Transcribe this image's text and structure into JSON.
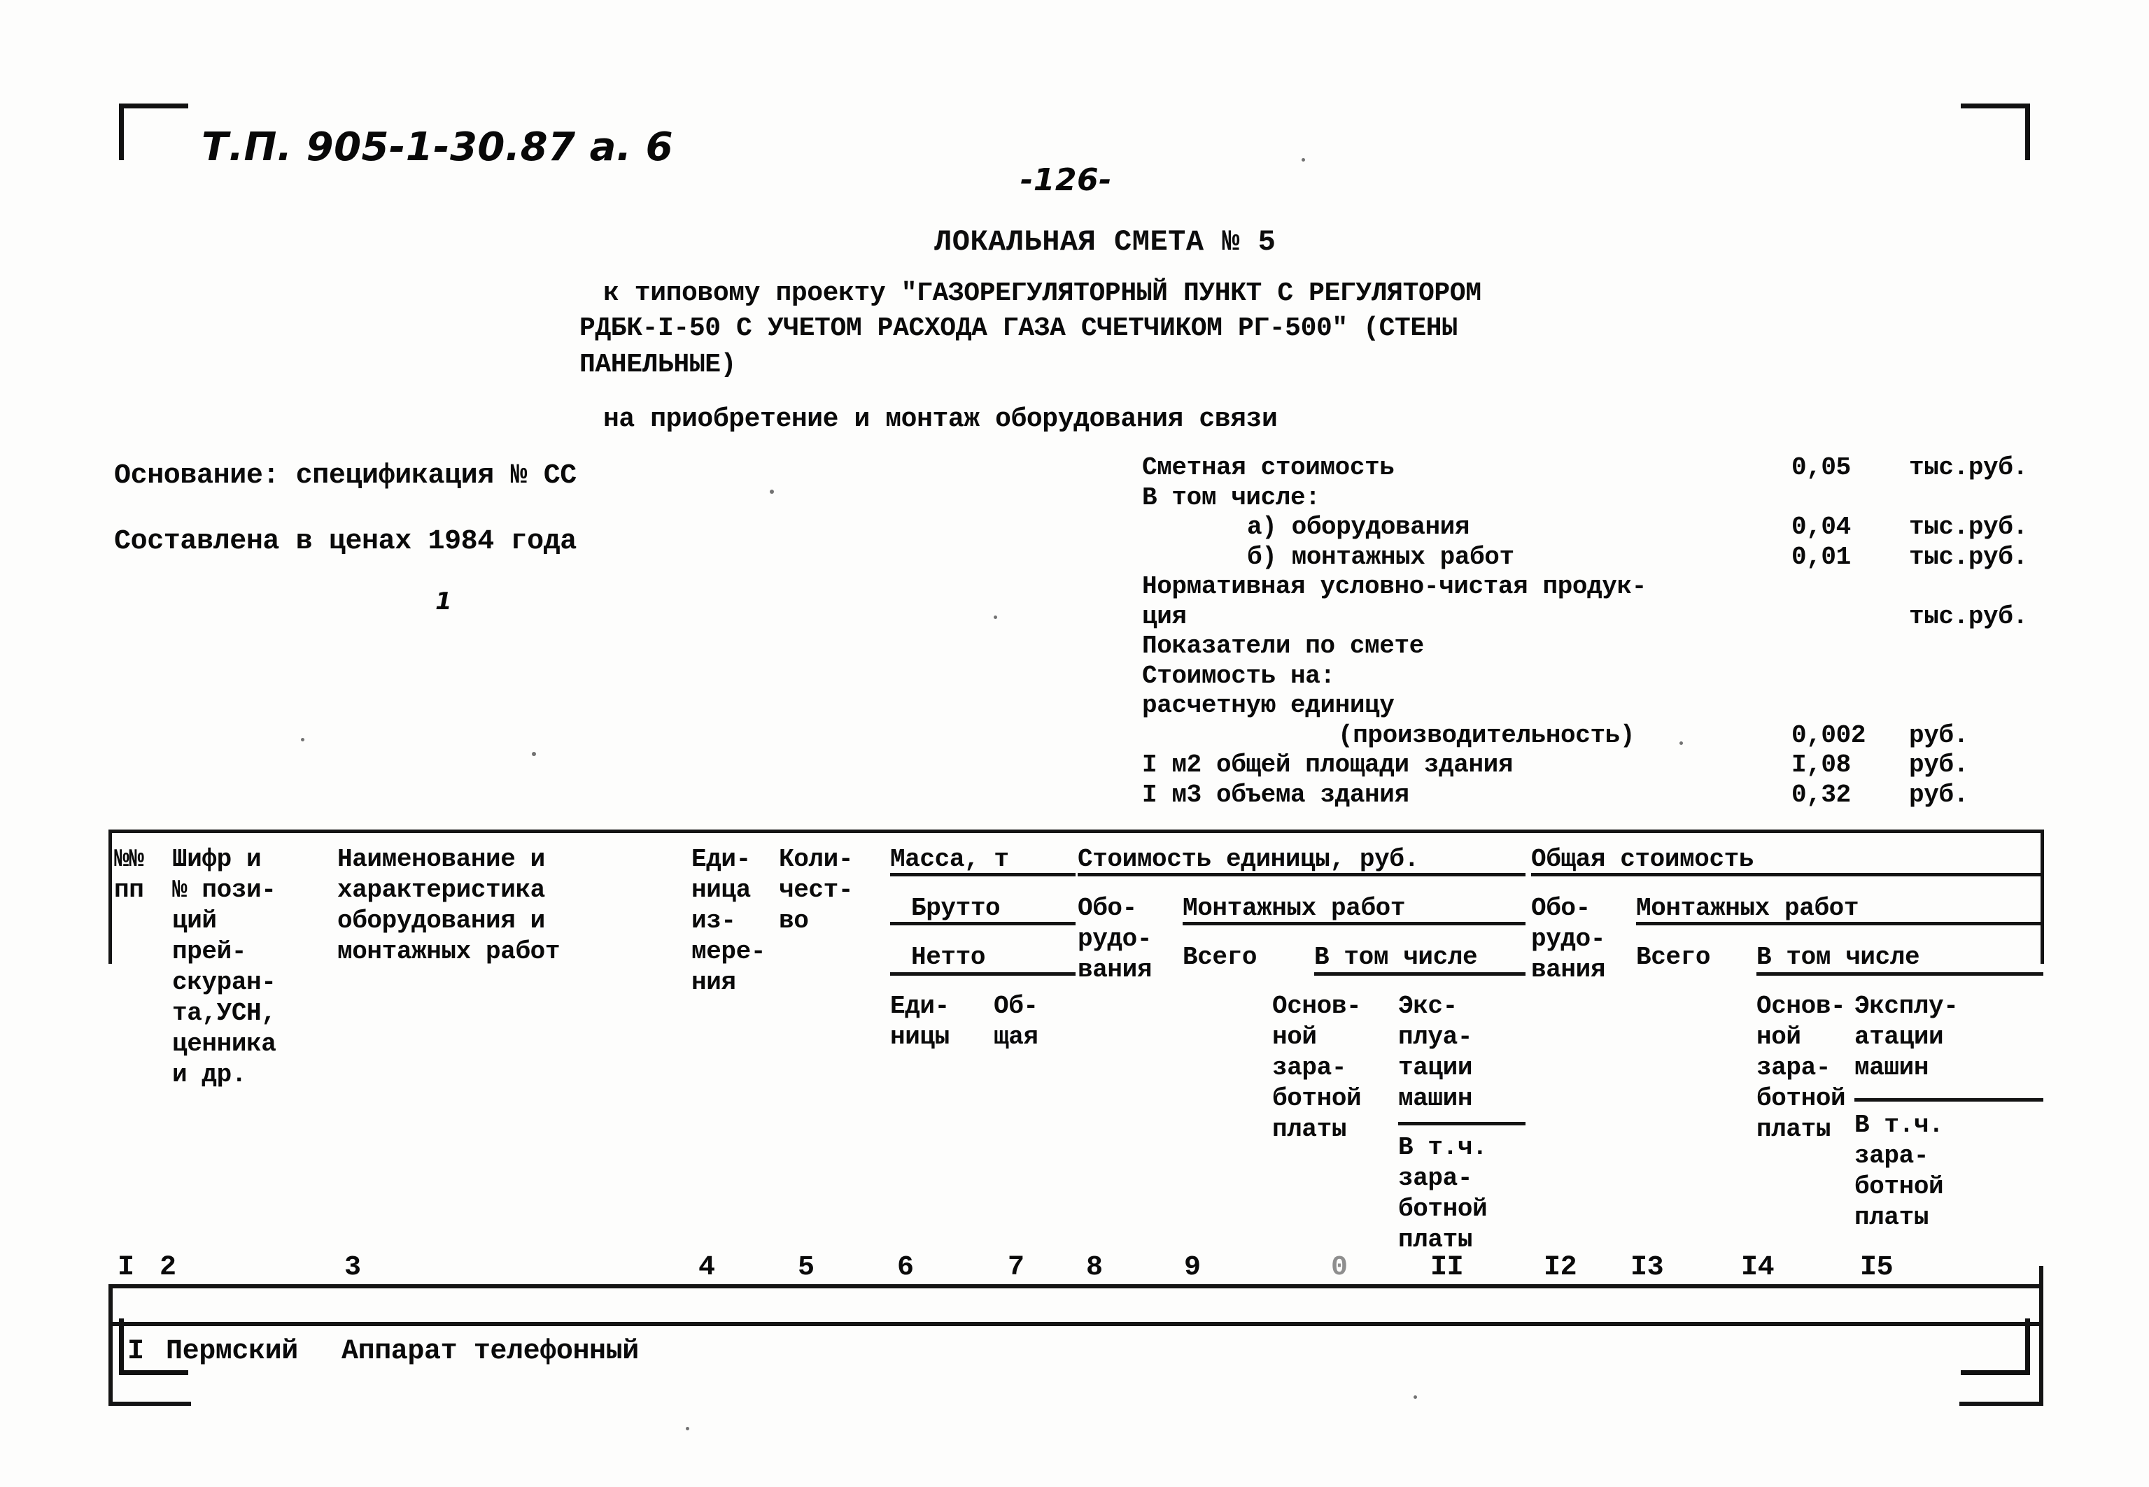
{
  "page": {
    "handwritten_ref": "Т.П. 905-1-30.87 а. 6",
    "page_number": "-126-"
  },
  "heading": {
    "title": "ЛОКАЛЬНАЯ СМЕТА № 5",
    "project_line1": "к типовому проекту \"ГАЗОРЕГУЛЯТОРНЫЙ ПУНКТ С РЕГУЛЯТОРОМ",
    "project_line2": "РДБК-I-50 С УЧЕТОМ РАСХОДА ГАЗА СЧЕТЧИКОМ РГ-500\" (СТЕНЫ",
    "project_line3": "ПАНЕЛЬНЫЕ)",
    "subtitle": "на приобретение и монтаж оборудования связи"
  },
  "left_info": {
    "basis": "Основание: спецификация № СС",
    "prices": "Составлена в ценах 1984 года"
  },
  "summary": {
    "rows": [
      {
        "label": "Сметная стоимость",
        "value": "0,05",
        "unit": "тыс.руб."
      },
      {
        "label": "В том числе:",
        "value": "",
        "unit": ""
      },
      {
        "label": "а) оборудования",
        "value": "0,04",
        "unit": "тыс.руб.",
        "indent": 1
      },
      {
        "label": "б) монтажных работ",
        "value": "0,01",
        "unit": "тыс.руб.",
        "indent": 1
      },
      {
        "label": "Нормативная условно-чистая продук-",
        "value": "",
        "unit": ""
      },
      {
        "label": "ция",
        "value": "",
        "unit": "тыс.руб."
      },
      {
        "label": "Показатели по смете",
        "value": "",
        "unit": ""
      },
      {
        "label": "Стоимость на:",
        "value": "",
        "unit": ""
      },
      {
        "label": "расчетную единицу",
        "value": "",
        "unit": ""
      },
      {
        "label": "(производительность)",
        "value": "0,002",
        "unit": "руб.",
        "indent": 2
      },
      {
        "label": "I м2 общей площади здания",
        "value": "I,08",
        "unit": "руб."
      },
      {
        "label": "I м3 объема здания",
        "value": "0,32",
        "unit": "руб."
      }
    ]
  },
  "table": {
    "header": {
      "col1": [
        "№№",
        "пп"
      ],
      "col2": [
        "Шифр и",
        "№ пози-",
        "ций",
        "прей-",
        "скуран-",
        "та,УСН,",
        "ценника",
        "и др."
      ],
      "col3": [
        "Наименование и",
        "характеристика",
        "оборудования и",
        "монтажных работ"
      ],
      "col4": [
        "Еди-",
        "ница",
        "из-",
        "мере-",
        "ния"
      ],
      "col5": [
        "Коли-",
        "чест-",
        "во"
      ],
      "mass_group": "Масса, т",
      "mass_gross": "Брутто",
      "mass_net": "Нетто",
      "mass_unit": [
        "Еди-",
        "ницы"
      ],
      "mass_total": [
        "Об-",
        "щая"
      ],
      "unit_cost_group": "Стоимость единицы, руб.",
      "unit_equipment": [
        "Обо-",
        "рудо-",
        "вания"
      ],
      "unit_install_group": "Монтажных работ",
      "unit_total": "Всего",
      "unit_incl": "В том числе",
      "unit_basic_wage": [
        "Основ-",
        "ной",
        "зара-",
        "ботной",
        "платы"
      ],
      "unit_machines": [
        "Экс-",
        "плуа-",
        "тации",
        "машин"
      ],
      "unit_machines_incl": [
        "В т.ч.",
        "зара-",
        "ботной",
        "платы"
      ],
      "total_cost_group": "Общая стоимость",
      "total_equipment": [
        "Обо-",
        "рудо-",
        "вания"
      ],
      "total_install_group": "Монтажных работ",
      "total_total": "Всего",
      "total_incl": "В том числе",
      "total_basic_wage": [
        "Основ-",
        "ной",
        "зара-",
        "ботной",
        "платы"
      ],
      "total_machines": [
        "Эксплу-",
        "атации",
        "машин"
      ],
      "total_machines_incl": [
        "В т.ч.",
        "зара-",
        "ботной",
        "платы"
      ]
    },
    "column_numbers": [
      "I",
      "2",
      "3",
      "4",
      "5",
      "6",
      "7",
      "8",
      "9",
      "0",
      "II",
      "I2",
      "I3",
      "I4",
      "I5"
    ],
    "rows": [
      {
        "num": "I",
        "code": "Пермский",
        "name": "Аппарат телефонный",
        "unit": "",
        "qty": "",
        "mass_unit": "",
        "mass_total": "",
        "unit_equipment": "",
        "unit_install_total": "",
        "unit_basic_wage": "",
        "unit_machines": "",
        "total_equipment": "",
        "total_install_total": "",
        "total_basic_wage": "",
        "total_machines": ""
      }
    ]
  }
}
